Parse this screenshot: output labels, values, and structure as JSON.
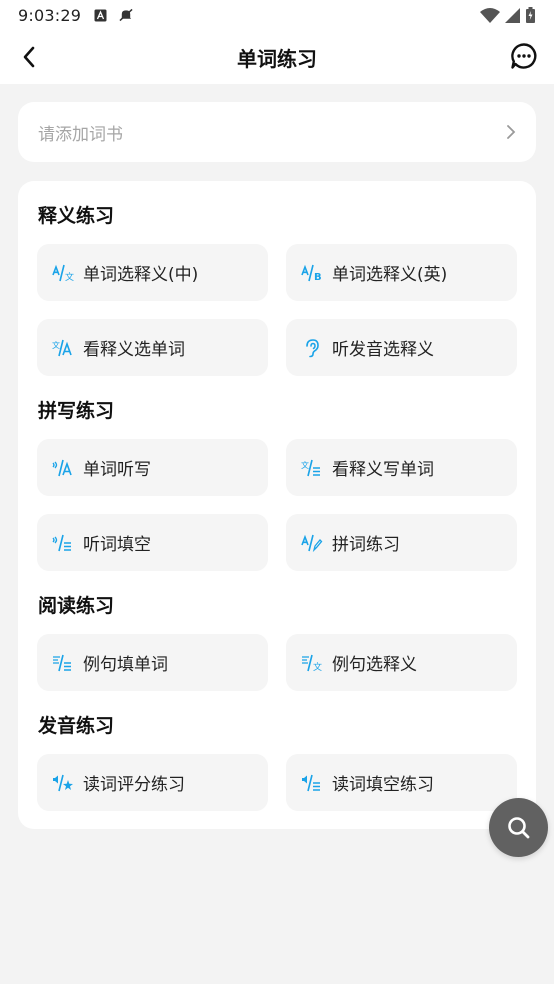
{
  "status_bar": {
    "time": "9:03:29"
  },
  "header": {
    "title": "单词练习"
  },
  "add_book": {
    "placeholder": "请添加词书"
  },
  "sections": [
    {
      "title": "释义练习",
      "items": [
        {
          "label": "单词选释义(中)",
          "icon": "word-to-chinese-icon"
        },
        {
          "label": "单词选释义(英)",
          "icon": "word-to-english-icon"
        },
        {
          "label": "看释义选单词",
          "icon": "meaning-to-word-icon"
        },
        {
          "label": "听发音选释义",
          "icon": "ear-icon"
        }
      ]
    },
    {
      "title": "拼写练习",
      "items": [
        {
          "label": "单词听写",
          "icon": "dictation-icon"
        },
        {
          "label": "看释义写单词",
          "icon": "meaning-write-icon"
        },
        {
          "label": "听词填空",
          "icon": "listen-fill-icon"
        },
        {
          "label": "拼词练习",
          "icon": "spell-icon"
        }
      ]
    },
    {
      "title": "阅读练习",
      "items": [
        {
          "label": "例句填单词",
          "icon": "sentence-fill-icon"
        },
        {
          "label": "例句选释义",
          "icon": "sentence-meaning-icon"
        }
      ]
    },
    {
      "title": "发音练习",
      "items": [
        {
          "label": "读词评分练习",
          "icon": "read-score-icon"
        },
        {
          "label": "读词填空练习",
          "icon": "read-fill-icon"
        }
      ]
    }
  ],
  "colors": {
    "accent": "#1aa3e8",
    "card": "#ffffff",
    "background": "#f3f3f3",
    "item_bg": "#f5f5f5",
    "fab": "#616161"
  }
}
